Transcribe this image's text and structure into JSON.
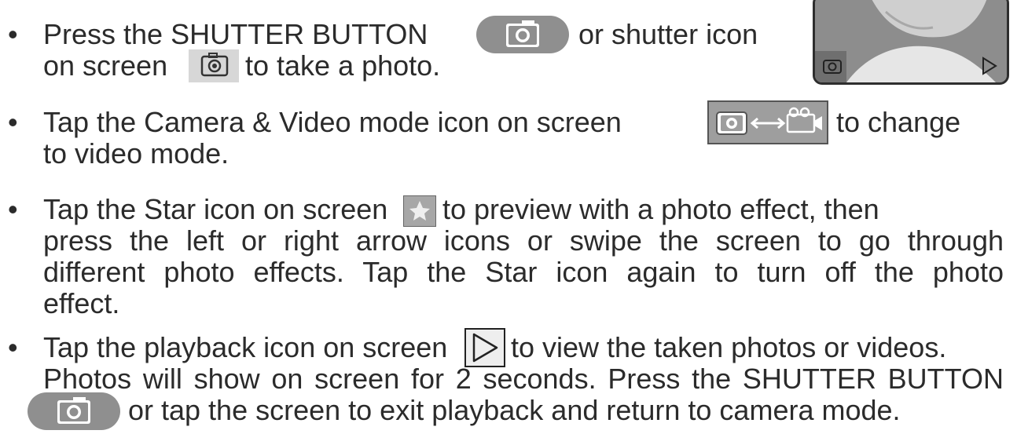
{
  "items": [
    {
      "lines": [
        "Press the SHUTTER BUTTON",
        "or shutter icon",
        "on screen",
        "to take a photo."
      ]
    },
    {
      "lines": [
        "Tap the Camera & Video mode icon on screen",
        "to change",
        "to video mode."
      ]
    },
    {
      "lines": [
        "Tap the Star icon on screen",
        "to preview with a photo effect, then",
        "press the left or right arrow icons or swipe the screen to go through",
        "different photo effects. Tap the Star icon again to turn off the photo",
        "effect."
      ]
    },
    {
      "lines": [
        "Tap the playback icon on screen",
        "to view the taken photos or videos.",
        "Photos will show on screen for 2 seconds. Press the SHUTTER BUTTON",
        "or tap the screen to exit playback and return to camera mode."
      ]
    }
  ],
  "bullet": "•",
  "icons": {
    "shutter_button": "camera-icon",
    "shutter_on_screen": "camera-outline-icon",
    "mode_toggle": "camera-video-toggle-icon",
    "star": "star-icon",
    "playback": "play-triangle-icon"
  },
  "colors": {
    "text": "#2b2b2b",
    "pill": "#8f8f8f"
  }
}
